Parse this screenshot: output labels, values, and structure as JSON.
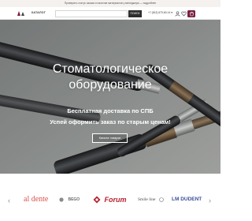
{
  "promo_bar": {
    "text": "Проверить статус заказа и наличие материалов у менеджера — подробнее"
  },
  "header": {
    "catalog_label": "КАТАЛОГ",
    "search": {
      "value": "",
      "placeholder": ""
    },
    "search_button_label": "ПОИСК",
    "phone": "+7 (812) 670-60-14 ▾",
    "icons": [
      "user-icon",
      "heart-icon",
      "cart-icon"
    ],
    "cart_badge_color": "#7a1e3f"
  },
  "hero": {
    "title_line1": "Стоматологическое",
    "title_line2": "оборудование",
    "line1": "Бесплатная доставка по СПБ",
    "line2": "Успей оформить заказ по старым ценам!",
    "cta_label": "Каталог товаров"
  },
  "brands": {
    "items": [
      {
        "name": "al dente",
        "color": "#d9534f"
      },
      {
        "name": "BEGO",
        "color": "#6a6a6a"
      },
      {
        "name": "Forum",
        "color": "#b51f2e"
      },
      {
        "name": "Smile line",
        "color": "#4a4a4a"
      },
      {
        "name": "LM DUDENT",
        "color": "#3b4f9a"
      }
    ]
  }
}
